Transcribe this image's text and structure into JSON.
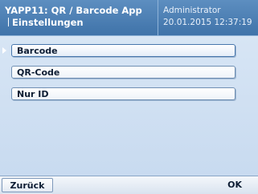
{
  "header": {
    "title": "YAPP11: QR / Barcode App",
    "subtitle": "Einstellungen",
    "user": "Administrator",
    "timestamp": "20.01.2015 12:37:19"
  },
  "options": [
    {
      "label": "Barcode",
      "selected": true
    },
    {
      "label": "QR-Code",
      "selected": false
    },
    {
      "label": "Nur ID",
      "selected": false
    }
  ],
  "footer": {
    "back_label": "Zurück",
    "ok_label": "OK"
  },
  "icons": {
    "selection_marker": "triangle-right-icon"
  }
}
